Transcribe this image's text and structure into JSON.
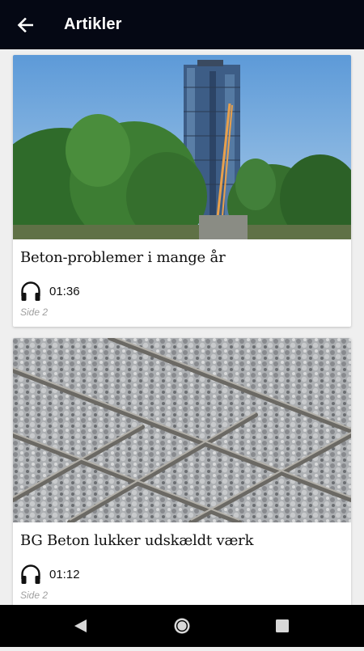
{
  "appbar": {
    "title": "Artikler",
    "back_icon": "arrow-left-icon"
  },
  "articles": [
    {
      "title": "Beton-problemer i mange år",
      "duration": "01:36",
      "page_ref": "Side 2",
      "audio_icon": "headphones-icon",
      "image": "photo of a tall glass tower under construction behind green trees against blue sky"
    },
    {
      "title": "BG Beton lukker udskældt værk",
      "duration": "01:12",
      "page_ref": "Side 2",
      "audio_icon": "headphones-icon",
      "image": "close-up photo of fresh concrete poured over steel rebar mesh"
    }
  ],
  "navbar": {
    "back_icon": "triangle-back-icon",
    "home_icon": "circle-home-icon",
    "recents_icon": "square-recents-icon"
  },
  "colors": {
    "appbar_bg": "#050814",
    "page_bg": "#efefef",
    "card_bg": "#ffffff",
    "navbar_bg": "#000000",
    "secondary_text": "#a0a0a0"
  }
}
